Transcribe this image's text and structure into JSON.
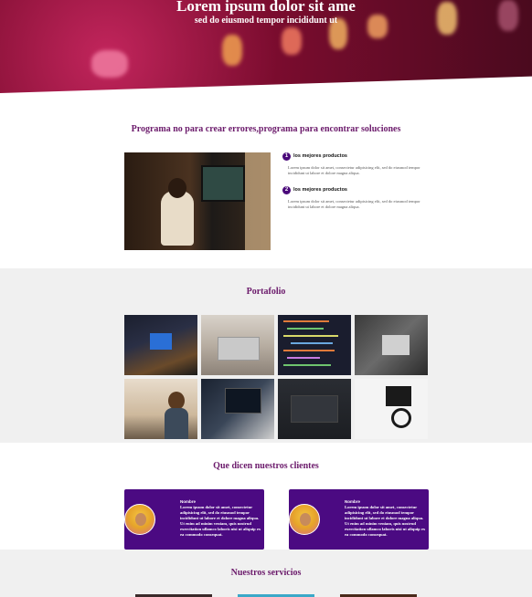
{
  "hero": {
    "title": "Lorem ipsum dolor sit ame",
    "subtitle": "sed do eiusmod tempor incididunt ut"
  },
  "intro": {
    "title": "Programa no para crear errores,programa para encontrar soluciones",
    "features": [
      {
        "num": "1",
        "title": "los mejores productos",
        "text": "Lorem ipsum dolor sit amet, consectetur adipisicing elit, sed do eiusmod tempor incididunt ut labore et dolore magna aliqua."
      },
      {
        "num": "2",
        "title": "los mejores productos",
        "text": "Lorem ipsum dolor sit amet, consectetur adipisicing elit, sed do eiusmod tempor incididunt ut labore et dolore magna aliqua."
      }
    ]
  },
  "portfolio": {
    "title": "Portafolio"
  },
  "testimonials": {
    "title": "Que dicen nuestros clientes",
    "items": [
      {
        "name": "Nombre",
        "text": "Lorem ipsum dolor sit amet, consectetur adipisicing elit, sed do eiusmod tempor incididunt ut labore et dolore magna aliqua. Ut enim ad minim veniam, quis nostrud exercitation ullamco laboris nisi ut aliquip ex ea commodo consequat."
      },
      {
        "name": "Nombre",
        "text": "Lorem ipsum dolor sit amet, consectetur adipisicing elit, sed do eiusmod tempor incididunt ut labore et dolore magna aliqua. Ut enim ad minim veniam, quis nostrud exercitation ullamco laboris nisi ut aliquip ex ea commodo consequat."
      }
    ]
  },
  "services": {
    "title": "Nuestros servicios"
  },
  "colors": {
    "accent": "#6b1a6b",
    "card": "#4b0a82",
    "band": "#f0f0f0"
  }
}
